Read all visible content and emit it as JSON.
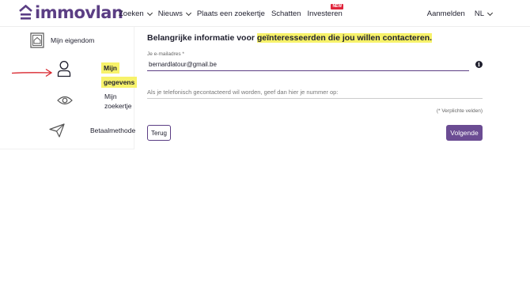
{
  "header": {
    "logo_text": "immovlan",
    "brand_color": "#5b3e84",
    "nav": [
      {
        "label": "Zoeken",
        "has_dropdown": true
      },
      {
        "label": "Nieuws",
        "has_dropdown": true
      },
      {
        "label": "Plaats een zoekertje",
        "has_dropdown": false
      },
      {
        "label": "Schatten",
        "has_dropdown": false
      },
      {
        "label": "Investeren",
        "has_dropdown": false,
        "badge": "NEW"
      }
    ],
    "login_label": "Aanmelden",
    "language": "NL"
  },
  "sidebar": {
    "items": [
      {
        "label": "Mijn eigendom",
        "icon": "property-icon",
        "active": false
      },
      {
        "label_line1": "Mijn",
        "label_line2": "gegevens",
        "icon": "user-icon",
        "active": true
      },
      {
        "label_line1": "Mijn",
        "label_line2": "zoekertje",
        "icon": "eye-icon",
        "active": false
      },
      {
        "label": "Betaalmethode",
        "icon": "send-icon",
        "active": false
      }
    ]
  },
  "main": {
    "title_plain": "Belangrijke informatie voor ",
    "title_highlight": "geïnteresseerden die jou willen contacteren.",
    "email_label": "Je e-mailadres *",
    "email_value": "bernardlatour@gmail.be",
    "phone_placeholder": "Als je telefonisch gecontacteerd wil worden, geef dan hier je nummer op:",
    "required_note": "(* Verplichte velden)",
    "back_label": "Terug",
    "next_label": "Volgende"
  },
  "colors": {
    "highlight": "#f7f26a",
    "annotation_arrow": "#d9262e",
    "button_primary": "#6b4c93"
  }
}
